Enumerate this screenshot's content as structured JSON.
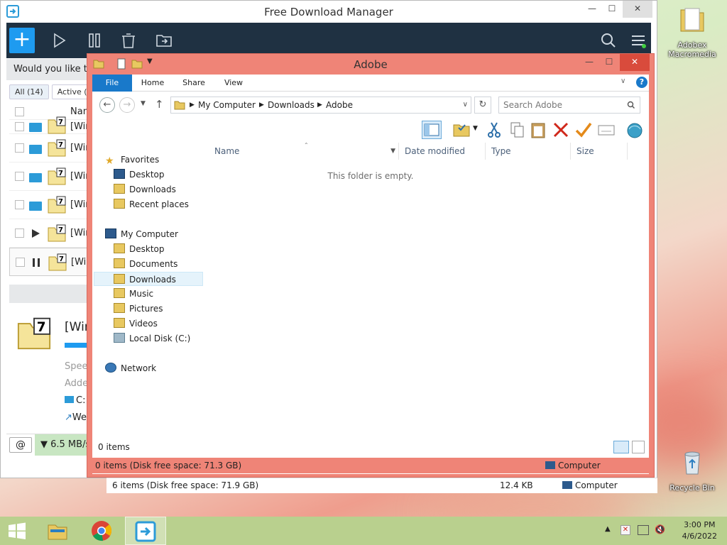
{
  "fdm": {
    "title": "Free Download Manager",
    "notice": "Would you like to",
    "filters": [
      "All (14)",
      "Active (1"
    ],
    "column_name": "Nam",
    "rows": [
      "[Win",
      "[Win",
      "[Win",
      "[Win",
      "[Win",
      "[Win"
    ],
    "detail": {
      "title": "[Win",
      "speed": "Spee",
      "added": "Adde",
      "path": "C:",
      "web": "We"
    },
    "speed": "▼ 6.5 MB/s",
    "bottom_status": {
      "items": "6 items (Disk free space: 71.9 GB)",
      "size": "12.4 KB",
      "location": "Computer"
    }
  },
  "explorer": {
    "title": "Adobe",
    "tabs": {
      "file": "File",
      "home": "Home",
      "share": "Share",
      "view": "View"
    },
    "breadcrumb": [
      "My Computer",
      "Downloads",
      "Adobe"
    ],
    "search_placeholder": "Search Adobe",
    "nav": {
      "favorites": "Favorites",
      "fav_items": [
        "Desktop",
        "Downloads",
        "Recent places"
      ],
      "computer": "My Computer",
      "computer_items": [
        "Desktop",
        "Documents",
        "Downloads",
        "Music",
        "Pictures",
        "Videos",
        "Local Disk (C:)"
      ],
      "network": "Network"
    },
    "columns": {
      "name": "Name",
      "date": "Date modified",
      "type": "Type",
      "size": "Size"
    },
    "empty": "This folder is empty.",
    "item_count": "0 items",
    "status": "0 items (Disk free space: 71.3 GB)",
    "status_location": "Computer"
  },
  "desktop": {
    "icons": [
      {
        "label": "Adobex Macromedia"
      },
      {
        "label": "Recycle Bin"
      }
    ]
  },
  "taskbar": {
    "time": "3:00 PM",
    "date": "4/6/2022"
  }
}
